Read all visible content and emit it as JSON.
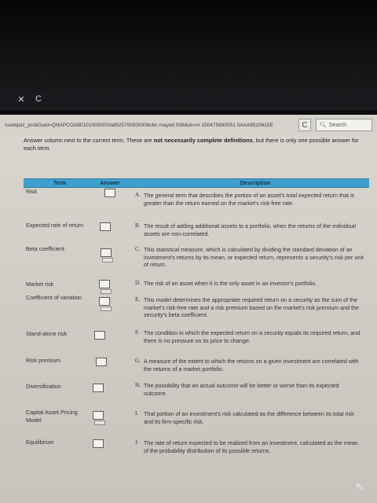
{
  "browser": {
    "tab_controls": [
      "✕",
      "C"
    ],
    "url": "ssedquiz_probGuid=QNAPCOA801010000003af925700500006cbc mayed 006&ck=m 150475690051 0AAA8510615E",
    "search_placeholder": "Search",
    "reload_glyph": "C"
  },
  "quiz": {
    "instructions_lead": "Answer column next to the correct term. These are ",
    "instructions_bold": "not necessarily complete definitions",
    "instructions_tail": ", but there is only one possible answer for each term.",
    "headers": {
      "term": "Term",
      "answer": "Answer",
      "description": "Description"
    },
    "terms": [
      "Risk",
      "Expected rate of return",
      "Beta coefficient",
      "Market risk",
      "Coefficient of variation",
      "Stand-alone risk",
      "Risk premium",
      "Diversification",
      "Capital Asset Pricing Model",
      "Equilibrium"
    ],
    "descriptions": [
      {
        "letter": "A.",
        "text": "The general term that describes the portion of an asset's total expected return that is greater than the return earned on the market's risk-free rate."
      },
      {
        "letter": "B.",
        "text": "The result of adding additional assets to a portfolio, when the returns of the individual assets are non-correlated."
      },
      {
        "letter": "C.",
        "text": "This statistical measure, which is calculated by dividing the standard deviation of an investment's returns by its mean, or expected return, represents a security's risk per unit of return."
      },
      {
        "letter": "D.",
        "text": "The risk of an asset when it is the only asset in an investor's portfolio."
      },
      {
        "letter": "E.",
        "text": "This model determines the appropriate required return on a security as the sum of the market's risk-free rate and a risk premium based on the market's risk premium and the security's beta coefficient."
      },
      {
        "letter": "F.",
        "text": "The condition in which the expected return on a security equals its required return, and there is no pressure on its price to change."
      },
      {
        "letter": "G.",
        "text": "A measure of the extent to which the returns on a given investment are correlated with the returns of a market portfolio."
      },
      {
        "letter": "H.",
        "text": "The possibility that an actual outcome will be better or worse than its expected outcome."
      },
      {
        "letter": "I.",
        "text": "That portion of an investment's risk calculated as the difference between its total risk and its firm-specific risk."
      },
      {
        "letter": "J.",
        "text": "The rate of return expected to be realized from an investment, calculated as the mean of the probability distribution of its possible returns."
      }
    ]
  }
}
